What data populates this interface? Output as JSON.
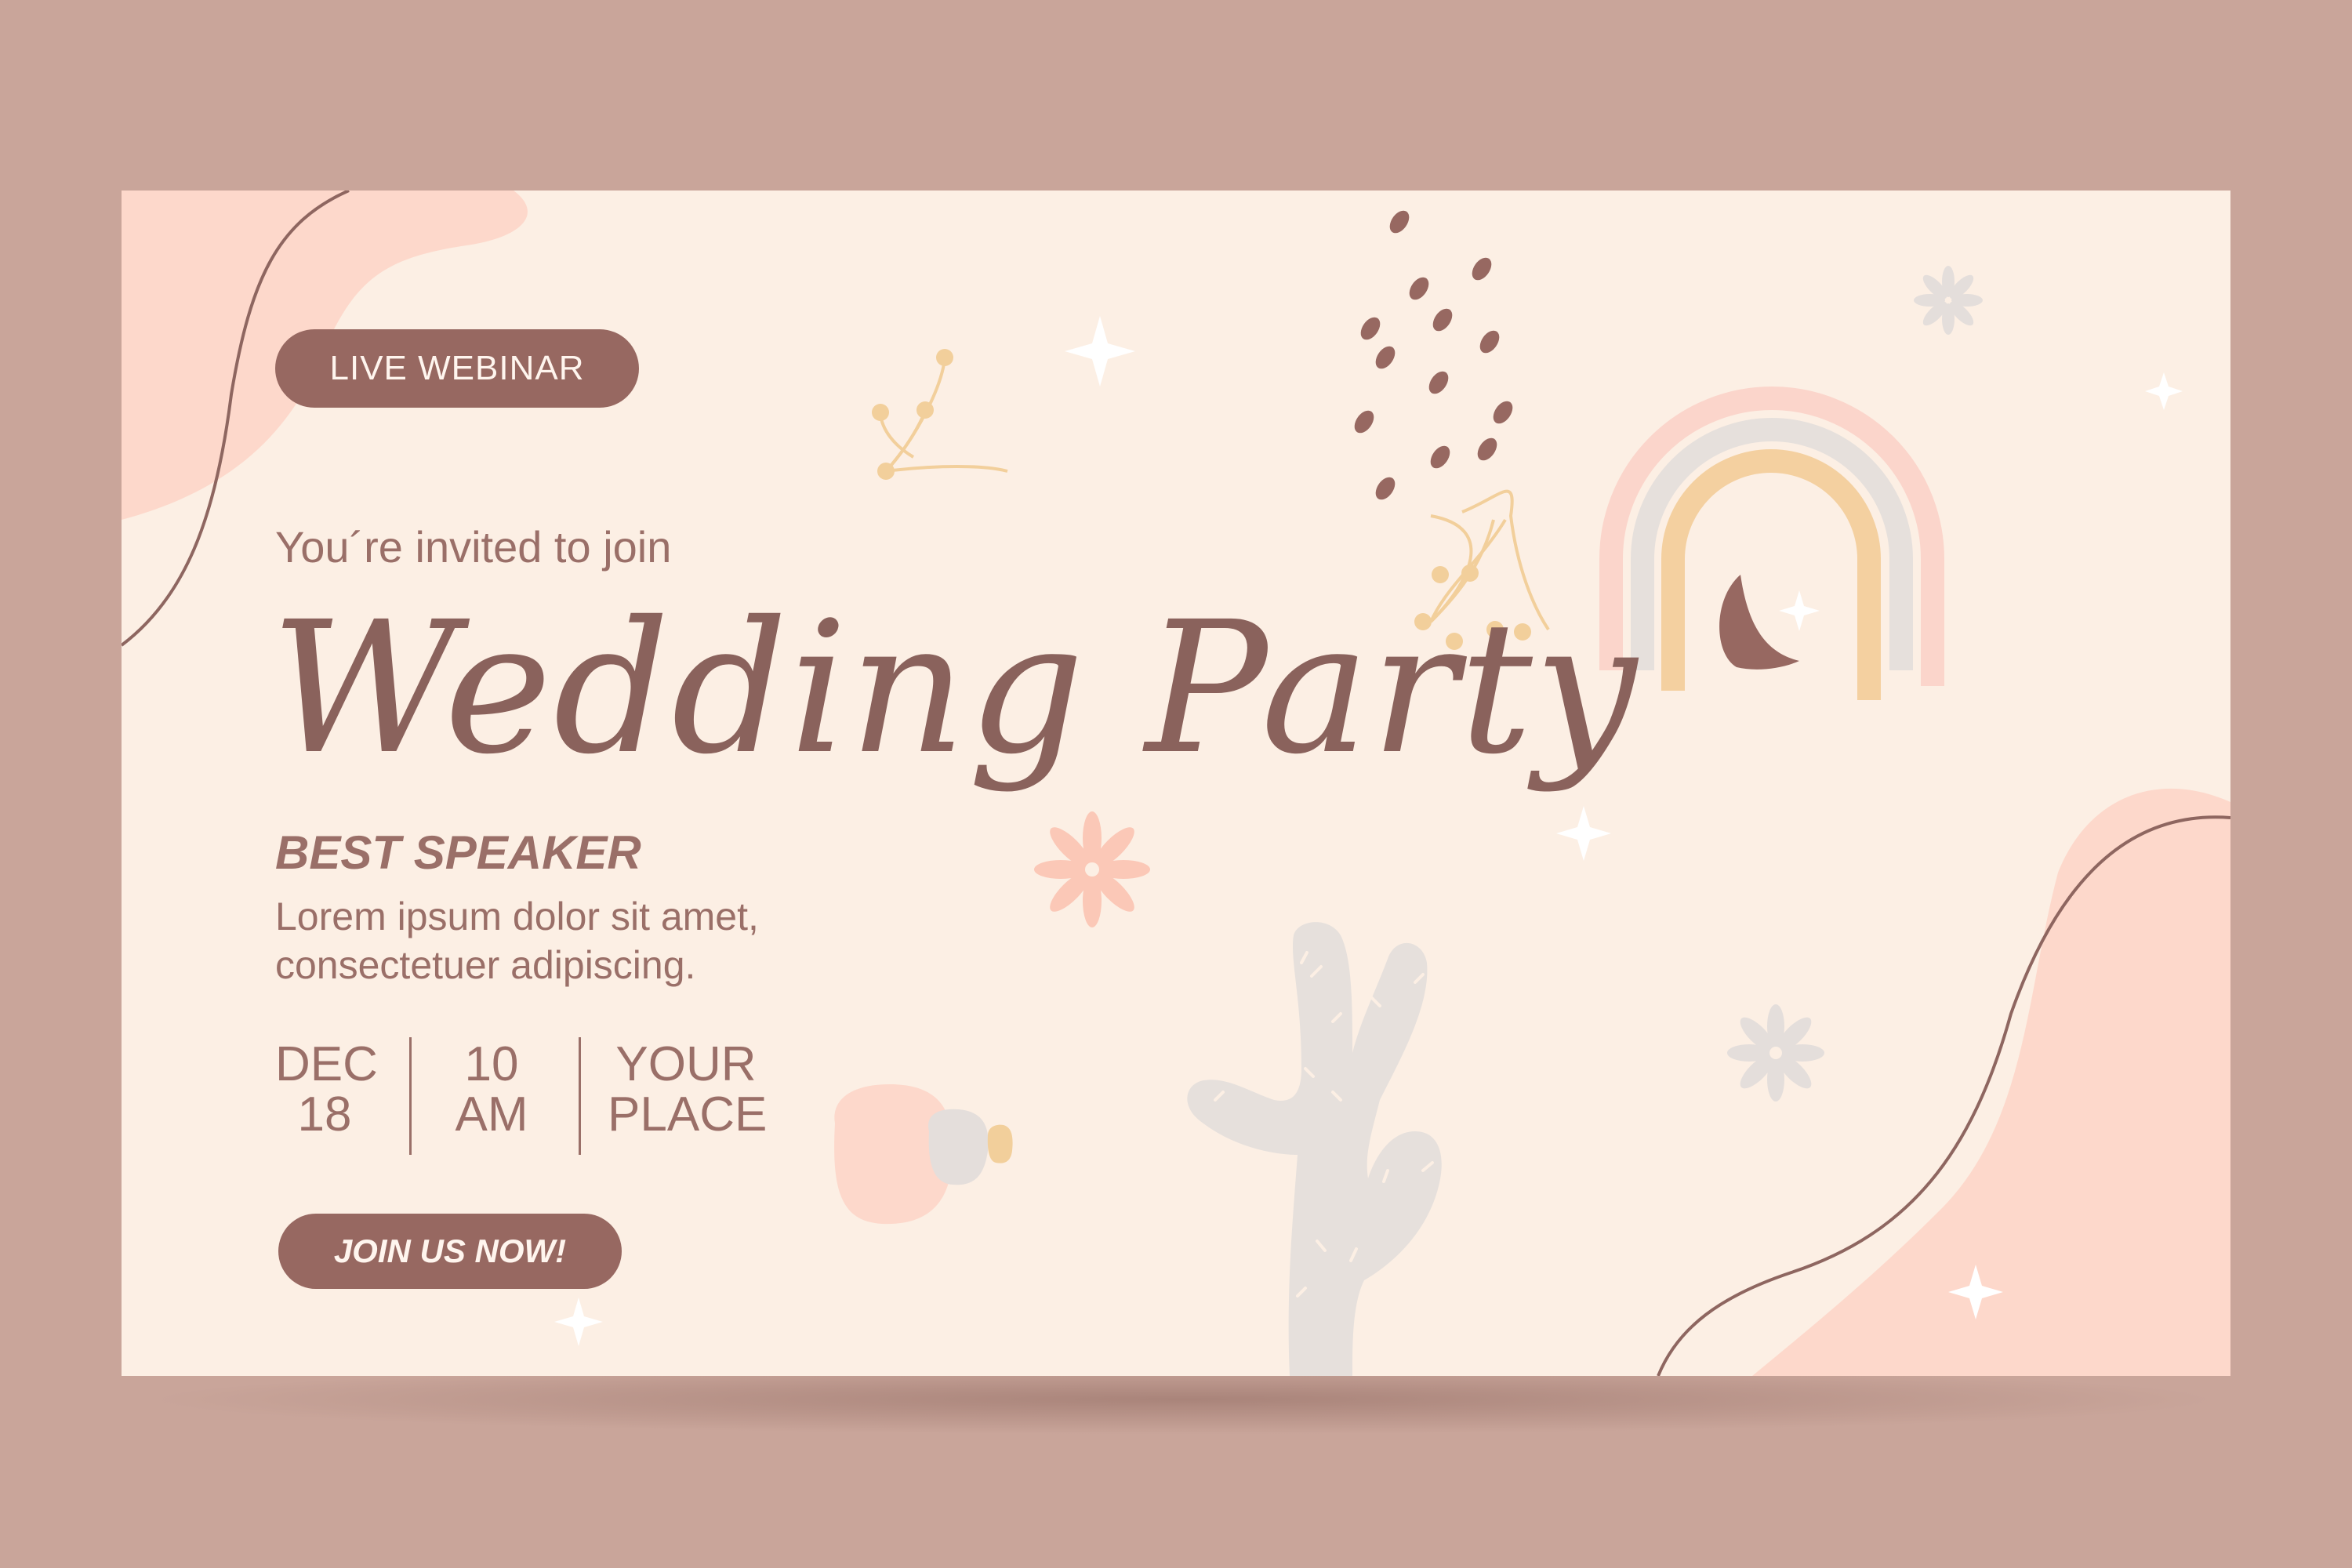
{
  "badge_label": "LIVE WEBINAR",
  "intro": "You´re invited to join",
  "title": "Wedding Party",
  "speaker": {
    "heading": "BEST SPEAKER",
    "description": "Lorem ipsum dolor sit amet, consectetuer adipiscing."
  },
  "event": {
    "month": "DEC",
    "day": "18",
    "hour": "10",
    "meridiem": "AM",
    "place_line1": "YOUR",
    "place_line2": "PLACE"
  },
  "cta_label": "JOIN US NOW!",
  "colors": {
    "background": "#c9a59a",
    "card": "#fcefe4",
    "accent": "#976861",
    "text": "#9a6f68",
    "blob": "#fdd8cb",
    "rainbow_outer": "#fbd5cb",
    "rainbow_middle": "#e6e0dc",
    "rainbow_inner": "#f4d0a0"
  }
}
